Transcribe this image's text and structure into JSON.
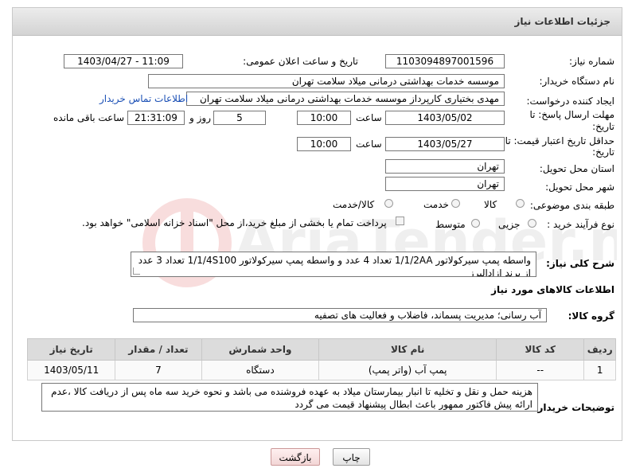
{
  "panel": {
    "title": "جزئیات اطلاعات نیاز"
  },
  "need_number": {
    "label": "شماره نیاز:",
    "value": "1103094897001596"
  },
  "announce": {
    "label": "تاریخ و ساعت اعلان عمومی:",
    "value": "1403/04/27 - 11:09"
  },
  "buyer_org": {
    "label": "نام دستگاه خریدار:",
    "value": "موسسه خدمات بهداشتی درمانی میلاد سلامت تهران"
  },
  "requester": {
    "label": "ایجاد کننده درخواست:",
    "value": "مهدی بختیاری کارپرداز موسسه خدمات بهداشتی درمانی میلاد سلامت تهران",
    "contact_link": "اطلاعات تماس خریدار"
  },
  "deadline": {
    "label_line1": "مهلت ارسال پاسخ: تا",
    "label_line2": "تاریخ:",
    "date": "1403/05/02",
    "time_label": "ساعت",
    "time": "10:00",
    "days": "5",
    "days_label": "روز و",
    "remaining": "21:31:09",
    "remaining_label": "ساعت باقی مانده"
  },
  "validity": {
    "label_line1": "حداقل تاریخ اعتبار قیمت: تا",
    "label_line2": "تاریخ:",
    "date": "1403/05/27",
    "time_label": "ساعت",
    "time": "10:00"
  },
  "province": {
    "label": "استان محل تحویل:",
    "value": "تهران"
  },
  "city": {
    "label": "شهر محل تحویل:",
    "value": "تهران"
  },
  "category": {
    "label": "طبقه بندی موضوعی:",
    "options": [
      "کالا",
      "خدمت",
      "کالا/خدمت"
    ]
  },
  "purchase_type": {
    "label": "نوع فرآیند خرید :",
    "options": [
      "جزیی",
      "متوسط"
    ],
    "note": "پرداخت تمام یا بخشی از مبلغ خرید،از محل \"اسناد خزانه اسلامی\" خواهد بود."
  },
  "description": {
    "label": "شرح کلی نیاز:",
    "value": "واسطه پمپ سیرکولاتور 1/1/2AA تعداد 4 عدد و واسطه پمپ سیرکولاتور 1/1/4S100 تعداد 3 عدد از برند ازادالبرز"
  },
  "goods_info_title": "اطلاعات کالاهای مورد نیاز",
  "goods_group": {
    "label": "گروه کالا:",
    "value": "آب رسانی؛ مدیریت پسماند، فاضلاب و فعالیت های تصفیه"
  },
  "table": {
    "headers": [
      "ردیف",
      "کد کالا",
      "نام کالا",
      "واحد شمارش",
      "تعداد / مقدار",
      "تاریخ نیاز"
    ],
    "rows": [
      [
        "1",
        "--",
        "پمپ آب (واتر پمپ)",
        "دستگاه",
        "7",
        "1403/05/11"
      ]
    ]
  },
  "buyer_notes": {
    "label": "توضیحات خریدار:",
    "value": "هزینه حمل و نقل و تخلیه تا انبار بیمارستان میلاد به عهده فروشنده می باشد و نحوه خرید سه ماه پس از دریافت کالا ،عدم ارائه پیش فاکتور ممهور باعث ابطال پیشنهاد قیمت می گردد"
  },
  "buttons": {
    "print": "چاپ",
    "back": "بازگشت"
  },
  "watermark": {
    "text": "AriaTender.net"
  }
}
